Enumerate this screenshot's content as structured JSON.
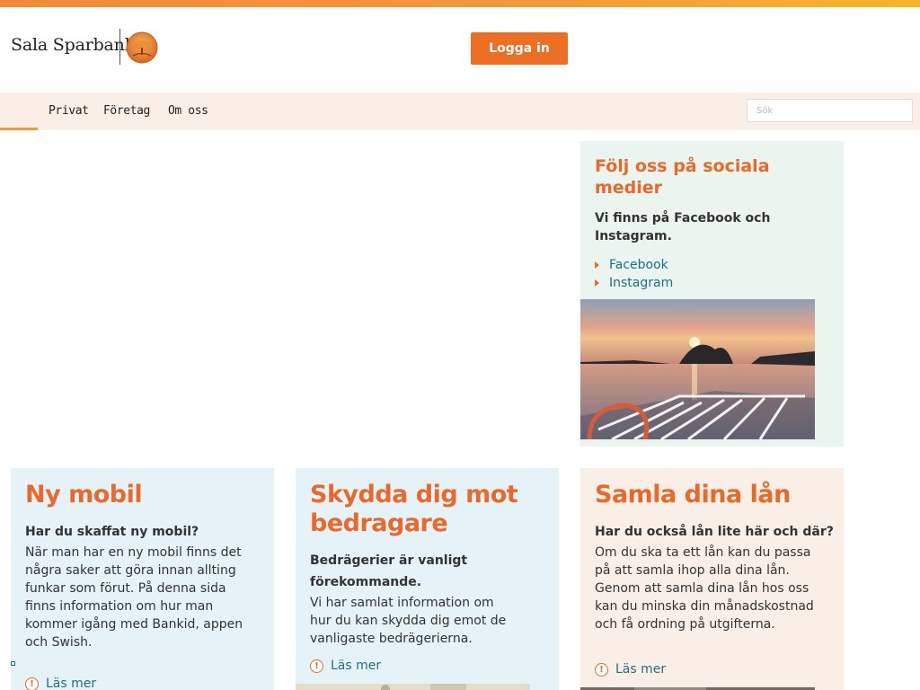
{
  "brand": {
    "name": "Sala Sparbank"
  },
  "header": {
    "login_label": "Logga in"
  },
  "nav": {
    "items": [
      {
        "label": "Privat"
      },
      {
        "label": "Företag"
      },
      {
        "label": "Om oss"
      }
    ],
    "search_placeholder": "Sök"
  },
  "social": {
    "title": "Följ oss på sociala medier",
    "lead": "Vi finns på Facebook och Instagram.",
    "links": [
      {
        "label": "Facebook"
      },
      {
        "label": "Instagram"
      }
    ]
  },
  "cards": [
    {
      "title": "Ny mobil",
      "question": "Har du skaffat ny mobil?",
      "body": "När man har en ny mobil finns det några saker att göra innan allting funkar som förut. På denna sida finns information om hur man kommer igång med Bankid, appen och Swish.",
      "more": "Läs mer"
    },
    {
      "title": "Skydda dig mot bedragare",
      "question": "Bedrägerier är vanligt förekommande.",
      "body": "Vi har samlat information om hur du kan skydda dig emot de vanligaste bedrägerierna.",
      "more": "Läs mer"
    },
    {
      "title": "Samla dina lån",
      "question": "Har du också lån lite här och där?",
      "body": "Om du ska ta ett lån kan du passa på att samla ihop alla dina lån. Genom att samla dina lån hos oss kan du minska din månadskostnad och få ordning på utgifterna.",
      "more": "Läs mer"
    }
  ],
  "colors": {
    "accent": "#ec6f24",
    "heading_orange": "#e8692a",
    "link_teal": "#1f6f7f",
    "nav_bg": "#f9efe6",
    "social_bg": "#eaf5ef",
    "card_blue": "#e5f2f7"
  },
  "icons": {
    "logo": "tree-emblem-icon",
    "bullet": "triangle-bullet-icon",
    "read_more": "info-circle-icon"
  }
}
